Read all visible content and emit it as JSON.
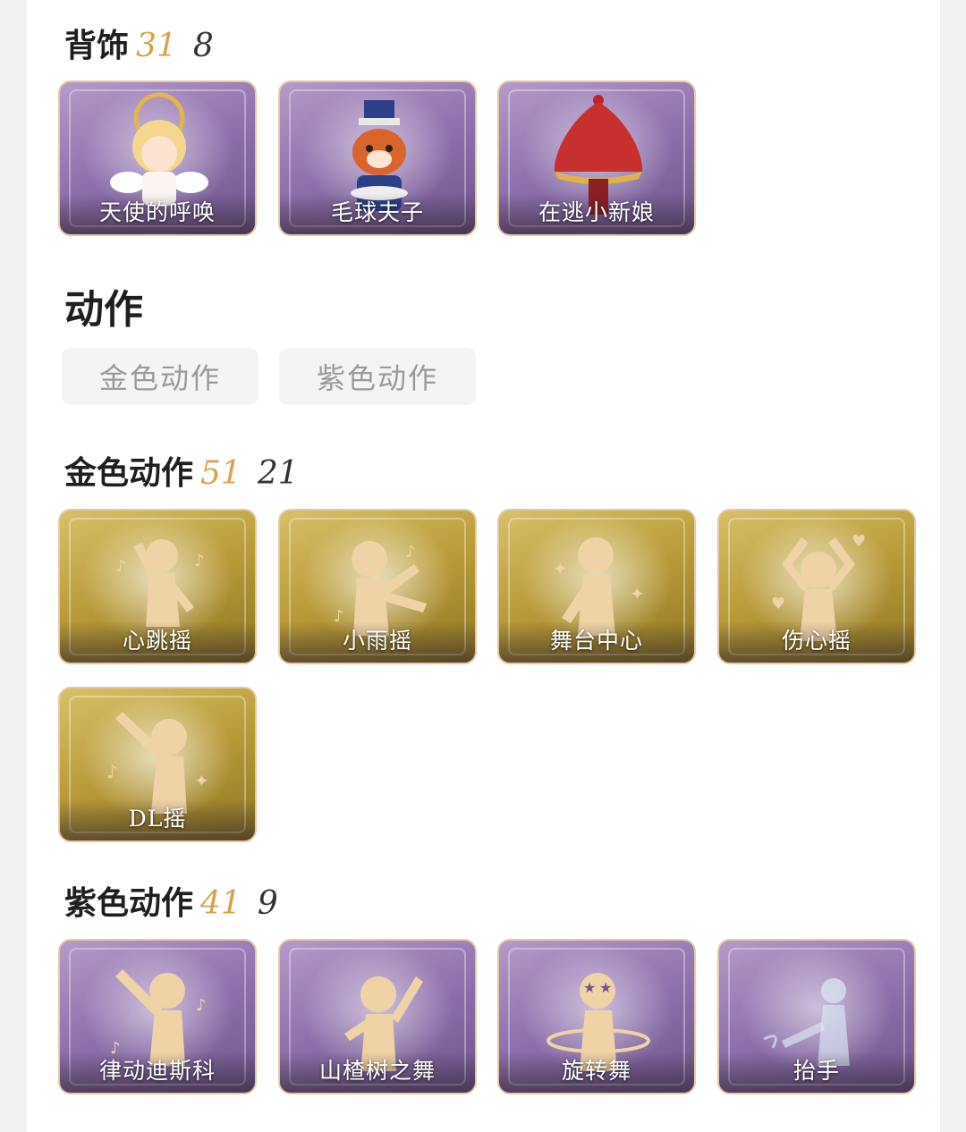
{
  "backpieces": {
    "title": "背饰",
    "owned": "31",
    "total": "8",
    "items": [
      {
        "label": "天使的呼唤",
        "icon": "angel-character-icon"
      },
      {
        "label": "毛球夫子",
        "icon": "raccoon-character-icon"
      },
      {
        "label": "在逃小新娘",
        "icon": "bride-veil-icon"
      }
    ]
  },
  "actions": {
    "title": "动作",
    "tabs": [
      {
        "label": "金色动作"
      },
      {
        "label": "紫色动作"
      }
    ]
  },
  "gold_actions": {
    "title": "金色动作",
    "owned": "51",
    "total": "21",
    "items": [
      {
        "label": "心跳摇",
        "icon": "dance-pose-icon"
      },
      {
        "label": "小雨摇",
        "icon": "dance-pose-icon"
      },
      {
        "label": "舞台中心",
        "icon": "dance-pose-icon"
      },
      {
        "label": "伤心摇",
        "icon": "heart-hands-pose-icon"
      },
      {
        "label": "DL摇",
        "icon": "dance-pose-icon"
      }
    ]
  },
  "purple_actions": {
    "title": "紫色动作",
    "owned": "41",
    "total": "9",
    "items": [
      {
        "label": "律动迪斯科",
        "icon": "dance-pose-icon"
      },
      {
        "label": "山楂树之舞",
        "icon": "dance-pose-icon"
      },
      {
        "label": "旋转舞",
        "icon": "spin-pose-icon"
      },
      {
        "label": "抬手",
        "icon": "ghost-pose-icon"
      }
    ]
  },
  "colors": {
    "accent_gold": "#d8a24a",
    "card_purple": "#8e70ac",
    "card_gold": "#b89a38",
    "figure": "#efd3a6"
  }
}
